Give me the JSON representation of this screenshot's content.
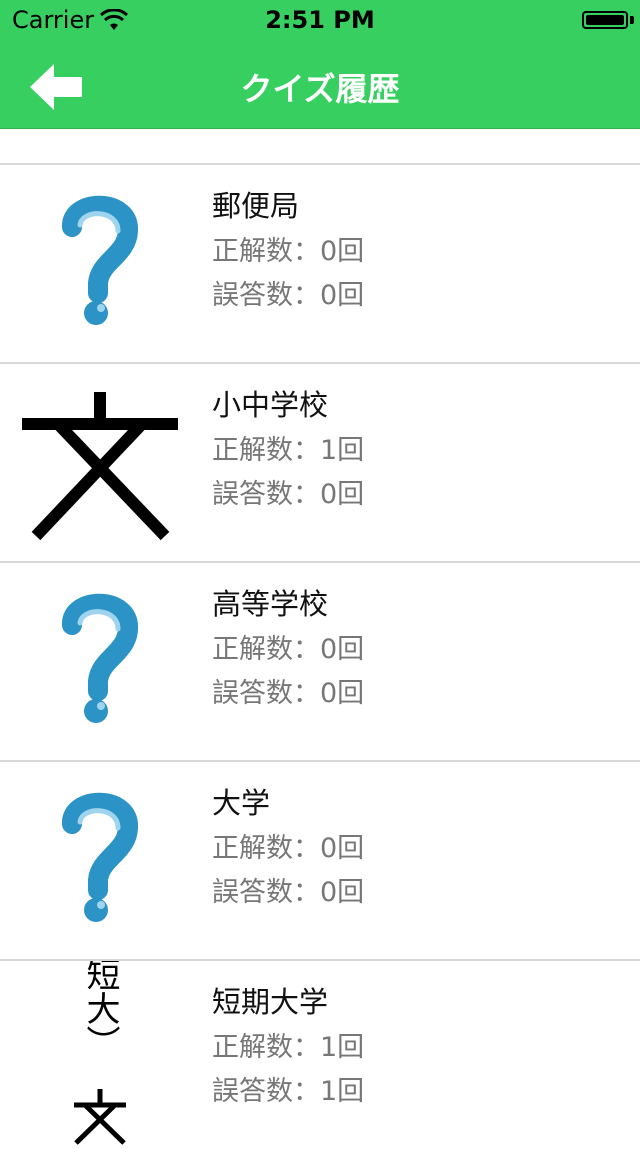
{
  "status_bar": {
    "carrier": "Carrier",
    "time": "2:51 PM"
  },
  "nav": {
    "title": "クイズ履歴",
    "back_icon": "back-arrow-icon",
    "bar_color": "#37d060"
  },
  "items": [
    {
      "title": "郵便局",
      "correct": "正解数：0回",
      "wrong": "誤答数：0回",
      "icon": "question-mark-icon"
    },
    {
      "title": "小中学校",
      "correct": "正解数：1回",
      "wrong": "誤答数：0回",
      "icon": "school-map-symbol-icon"
    },
    {
      "title": "高等学校",
      "correct": "正解数：0回",
      "wrong": "誤答数：0回",
      "icon": "question-mark-icon"
    },
    {
      "title": "大学",
      "correct": "正解数：0回",
      "wrong": "誤答数：0回",
      "icon": "question-mark-icon"
    },
    {
      "title": "短期大学",
      "correct": "正解数：1回",
      "wrong": "誤答数：1回",
      "icon": "junior-college-map-symbol-icon"
    }
  ],
  "thumb_text": {
    "junior_college_label": "（短大）"
  }
}
